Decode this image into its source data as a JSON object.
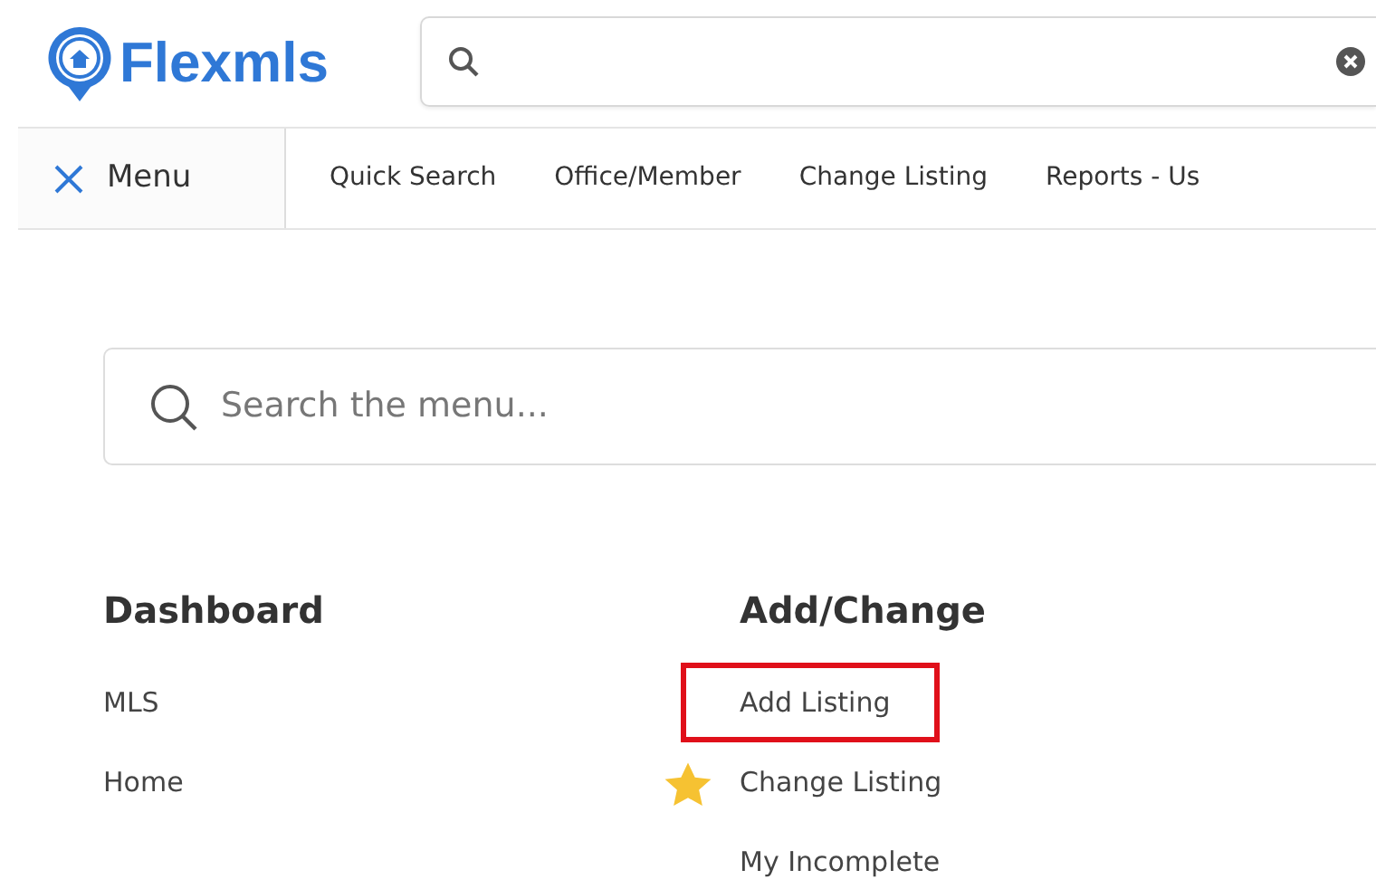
{
  "logo": {
    "text": "Flexmls"
  },
  "nav": {
    "menu_label": "Menu",
    "menu_open": true,
    "links": [
      {
        "label": "Quick Search"
      },
      {
        "label": "Office/Member"
      },
      {
        "label": "Change Listing"
      },
      {
        "label": "Reports - Us"
      }
    ]
  },
  "menu_search": {
    "placeholder": "Search the menu..."
  },
  "sections": [
    {
      "heading": "Dashboard",
      "items": [
        {
          "label": "MLS",
          "favorite": false,
          "highlighted": false
        },
        {
          "label": "Home",
          "favorite": false,
          "highlighted": false
        }
      ]
    },
    {
      "heading": "Add/Change",
      "items": [
        {
          "label": "Add Listing",
          "favorite": false,
          "highlighted": true
        },
        {
          "label": "Change Listing",
          "favorite": true,
          "highlighted": false
        },
        {
          "label": "My Incomplete",
          "favorite": false,
          "highlighted": false
        }
      ]
    }
  ]
}
